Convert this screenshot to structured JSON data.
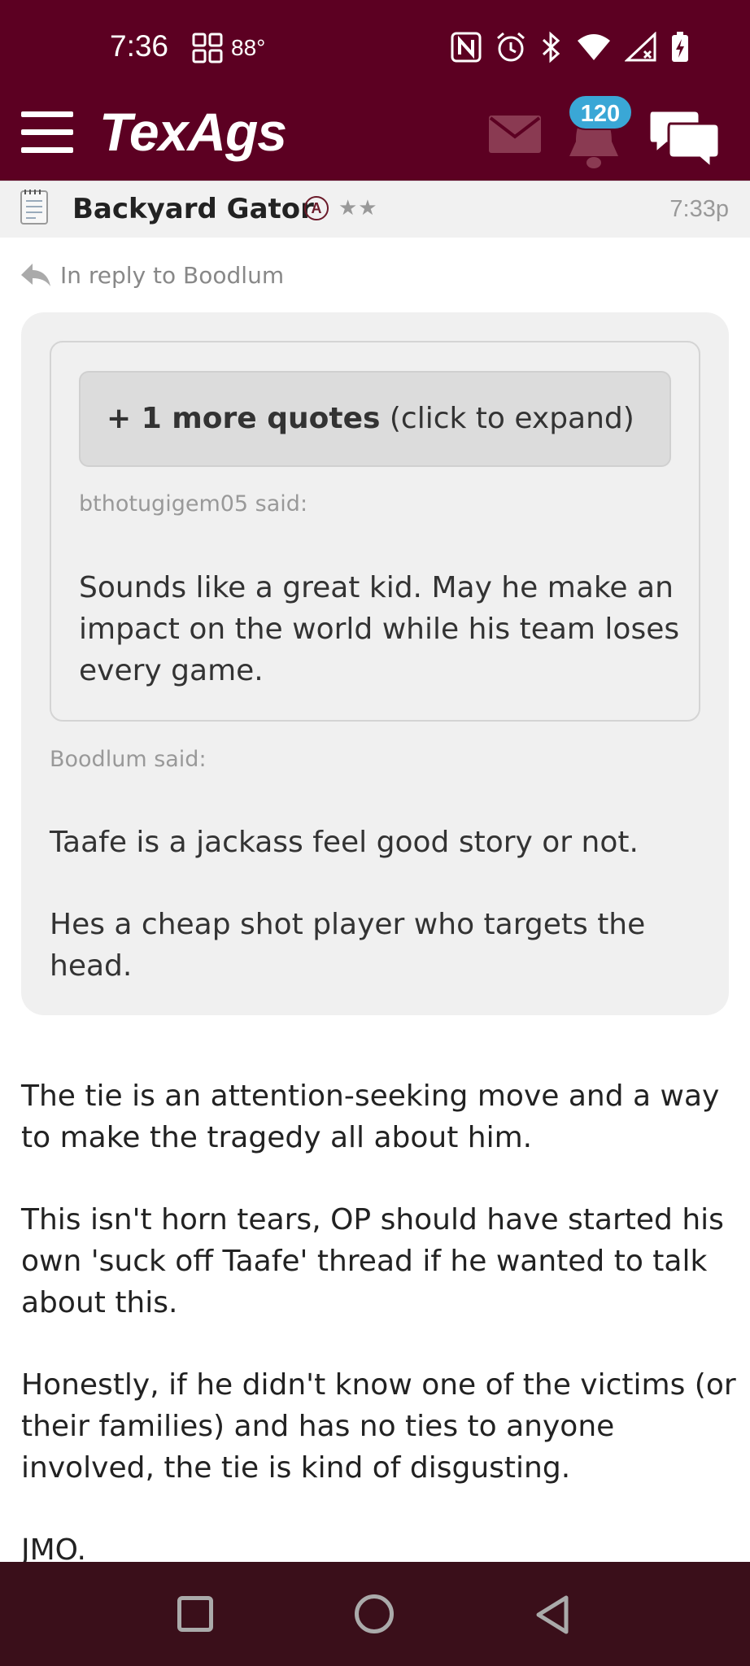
{
  "status_bar": {
    "time": "7:36",
    "temperature": "88°",
    "icons": [
      "grid-icon",
      "nfc-icon",
      "alarm-icon",
      "bluetooth-icon",
      "wifi-icon",
      "signal-icon",
      "battery-charging-icon"
    ]
  },
  "app_bar": {
    "logo": "TexAgs",
    "notification_count": "120",
    "icons": [
      "menu-icon",
      "mail-icon",
      "bell-icon",
      "chat-icon"
    ]
  },
  "post": {
    "author": "Backyard Gator",
    "rank_badge": "A",
    "stars": "★★",
    "time": "7:33p",
    "reply_to": "In reply to Boodlum",
    "quote": {
      "expand_bold": "+ 1 more quotes",
      "expand_rest": " (click to expand)",
      "inner_said": "bthotugigem05 said:",
      "inner_text": "Sounds like a great kid. May he make an impact on the world while his team loses every game.",
      "outer_said": "Boodlum said:",
      "outer_paragraphs": [
        "Taafe is a jackass feel good story or not.",
        "Hes a cheap shot player who targets the head."
      ]
    },
    "body_paragraphs": [
      "The tie is an attention-seeking move and a way to make the tragedy all about him.",
      "This isn't horn tears, OP should have started his own 'suck off Taafe' thread if he wanted to talk about this.",
      "Honestly, if he didn't know one of the victims (or their families) and has no ties to anyone involved, the tie is kind of disgusting.",
      "JMO."
    ]
  },
  "colors": {
    "maroon": "#5c0022",
    "nav_bar": "#3a0f1a",
    "badge_blue": "#3aa7d6",
    "quote_bg": "#f0f0f0"
  }
}
